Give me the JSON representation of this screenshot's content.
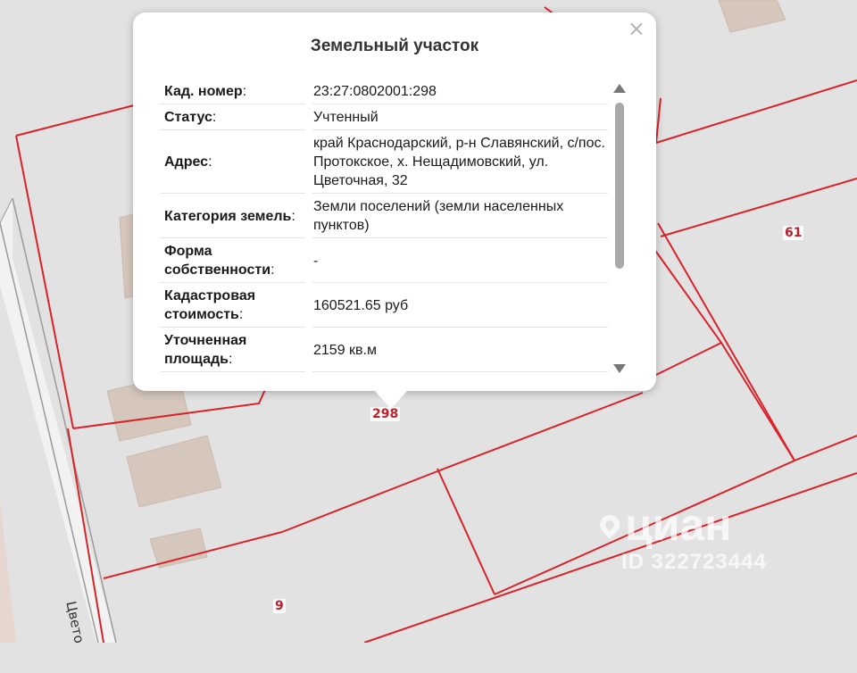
{
  "map": {
    "plot_labels": {
      "main": "298",
      "east": "61",
      "south": "9"
    },
    "street_label": "Цвето",
    "watermark": {
      "brand": "циан",
      "id": "ID 322723444"
    }
  },
  "popup": {
    "title": "Земельный участок",
    "close_symbol": "×",
    "rows": [
      {
        "key": "Кад. номер",
        "value": "23:27:0802001:298"
      },
      {
        "key": "Статус",
        "value": "Учтенный"
      },
      {
        "key": "Адрес",
        "value": "край Краснодарский, р-н Славянский, с/пос. Протокское, х. Нещадимовский, ул. Цветочная, 32"
      },
      {
        "key": "Категория земель",
        "value": "Земли поселений (земли населенных пунктов)"
      },
      {
        "key": "Форма собственности",
        "value": "-"
      },
      {
        "key": "Кадастровая стоимость",
        "value": "160521.65 руб"
      },
      {
        "key": "Уточненная площадь",
        "value": "2159 кв.м"
      }
    ]
  },
  "colors": {
    "boundary": "#d9222a",
    "map_bg": "#e2e2e2",
    "building": "#d6c7bd"
  }
}
